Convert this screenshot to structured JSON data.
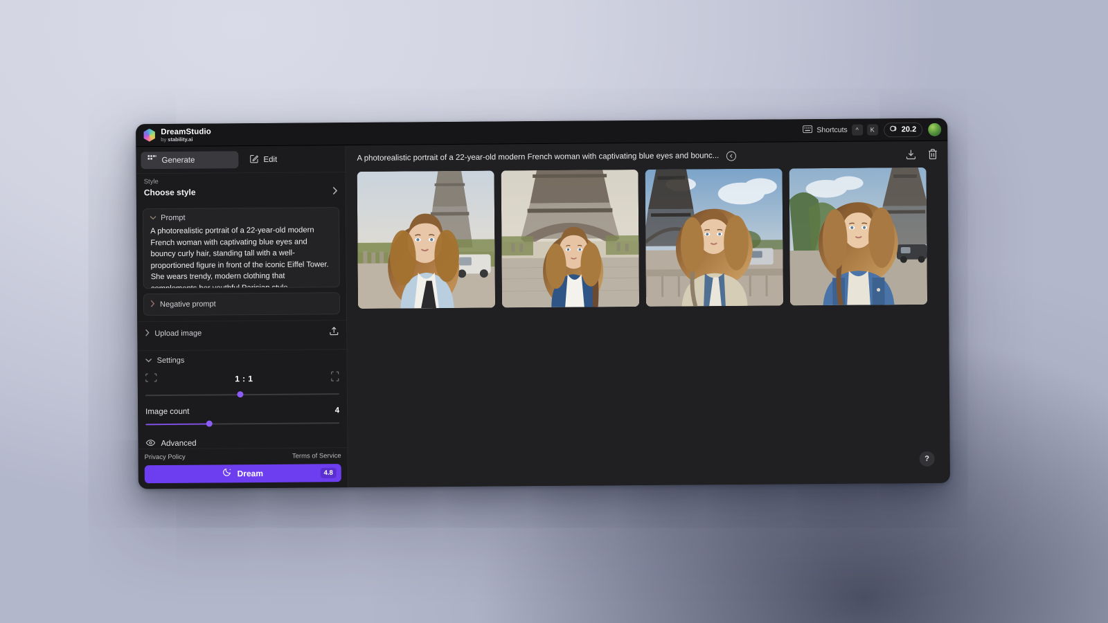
{
  "app": {
    "brand_name": "DreamStudio",
    "brand_by": "by",
    "brand_company": "stability.ai",
    "logo_icon": "dreamstudio-hexagon-logo"
  },
  "titlebar": {
    "shortcuts_label": "Shortcuts",
    "shortcuts_icon": "keyboard-icon",
    "key_modifier": "^",
    "key_letter": "K",
    "credits_icon": "coins-icon",
    "credits_value": "20.2",
    "avatar_icon": "user-avatar"
  },
  "sidebar": {
    "tabs": [
      {
        "label": "Generate",
        "icon": "grid-dots-icon",
        "active": true
      },
      {
        "label": "Edit",
        "icon": "pencil-square-icon",
        "active": false
      }
    ],
    "style": {
      "label": "Style",
      "value": "Choose style",
      "chevron_icon": "chevron-right-icon"
    },
    "prompt": {
      "header": "Prompt",
      "chevron_icon": "chevron-down-icon",
      "text": "A photorealistic portrait of a 22-year-old modern French woman with captivating blue eyes and bouncy curly hair, standing tall with a well-proportioned figure in front of the iconic Eiffel Tower. She wears trendy, modern clothing that complements her youthful Parisian style"
    },
    "negative_prompt": {
      "header": "Negative prompt",
      "chevron_icon": "chevron-right-icon"
    },
    "upload_image": {
      "header": "Upload image",
      "chevron_icon": "chevron-right-icon",
      "action_icon": "upload-icon"
    },
    "settings": {
      "header": "Settings",
      "chevron_icon": "chevron-down-icon",
      "aspect_ratio": {
        "value": "1 : 1",
        "landscape_icon": "landscape-frame-icon",
        "portrait_icon": "portrait-frame-icon",
        "slider_percent": 49
      },
      "image_count": {
        "label": "Image count",
        "value": "4",
        "slider_percent": 33
      },
      "advanced": {
        "label": "Advanced",
        "icon": "eye-icon"
      }
    },
    "footer": {
      "privacy_policy": "Privacy Policy",
      "terms_of_service": "Terms of Service",
      "dream_button": {
        "label": "Dream",
        "icon": "moon-icon",
        "cost_badge": "4.8"
      }
    }
  },
  "main": {
    "header": {
      "title": "A photorealistic portrait of a 22-year-old modern French woman with captivating blue eyes and bounc...",
      "collapse_icon": "circle-arrow-left-icon",
      "download_icon": "download-icon",
      "delete_icon": "trash-icon"
    },
    "results": [
      {
        "name": "result-image-1",
        "variant": "light-blue-jacket-street"
      },
      {
        "name": "result-image-2",
        "variant": "denim-jacket-under-tower"
      },
      {
        "name": "result-image-3",
        "variant": "beige-coat-bridge"
      },
      {
        "name": "result-image-4",
        "variant": "denim-jacket-avenue"
      }
    ],
    "help_button": "?"
  },
  "colors": {
    "accent_purple": "#6d3df0",
    "slider_purple": "#8b5cf6",
    "window_bg": "#1b1b1d",
    "main_bg": "#202023",
    "desktop_bg": "#d2d4e2"
  }
}
